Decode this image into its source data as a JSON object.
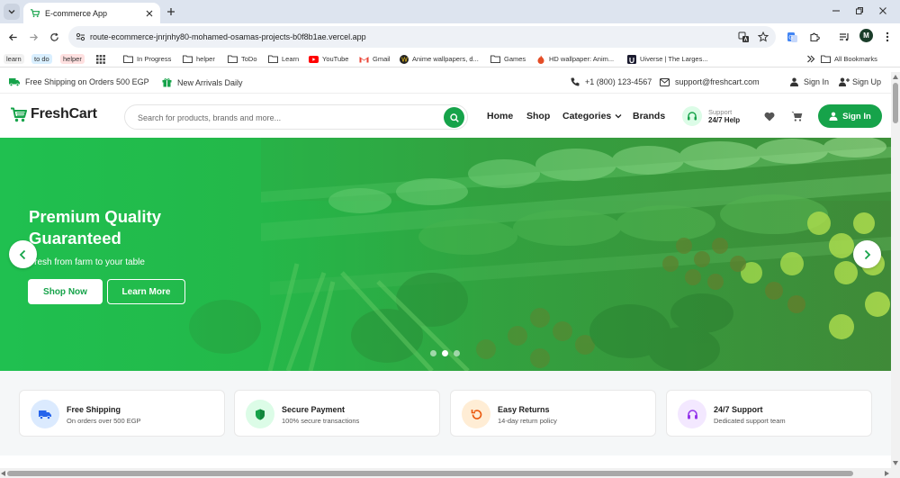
{
  "browser": {
    "tab_title": "E-commerce App",
    "url": "route-ecommerce-jnrjnhy80-mohamed-osamas-projects-b0f8b1ae.vercel.app",
    "profile_initial": "M",
    "bookmarks": [
      {
        "label": "learn",
        "icon": "chip"
      },
      {
        "label": "to do",
        "icon": "chip"
      },
      {
        "label": "helper",
        "icon": "chip"
      },
      {
        "label": "In Progress",
        "icon": "folder-icon"
      },
      {
        "label": "helper",
        "icon": "folder-icon"
      },
      {
        "label": "ToDo",
        "icon": "folder-icon"
      },
      {
        "label": "Learn",
        "icon": "folder-icon"
      },
      {
        "label": "YouTube",
        "icon": "youtube-icon"
      },
      {
        "label": "Gmail",
        "icon": "gmail-icon"
      },
      {
        "label": "Anime wallpapers, d...",
        "icon": "site-icon"
      },
      {
        "label": "Games",
        "icon": "folder-icon"
      },
      {
        "label": "HD wallpaper: Anim...",
        "icon": "site-icon"
      },
      {
        "label": "Uiverse | The Larges...",
        "icon": "site-icon"
      }
    ],
    "all_bookmarks": "All Bookmarks"
  },
  "topbar": {
    "shipping": "Free Shipping on Orders 500 EGP",
    "arrivals": "New Arrivals Daily",
    "phone": "+1 (800) 123-4567",
    "email": "support@freshcart.com",
    "sign_in": "Sign In",
    "sign_up": "Sign Up"
  },
  "header": {
    "logo": "FreshCart",
    "search_placeholder": "Search for products, brands and more...",
    "nav": [
      "Home",
      "Shop",
      "Categories",
      "Brands"
    ],
    "support_label": "Support",
    "support_hours": "24/7 Help",
    "sign_in_button": "Sign In"
  },
  "hero": {
    "title": "Premium Quality Guaranteed",
    "subtitle": "Fresh from farm to your table",
    "primary_button": "Shop Now",
    "secondary_button": "Learn More",
    "slides": 3,
    "active_slide": 2
  },
  "features": [
    {
      "title": "Free Shipping",
      "desc": "On orders over 500 EGP",
      "icon": "truck-icon",
      "color": "#2563eb",
      "bg": "#dbeafe"
    },
    {
      "title": "Secure Payment",
      "desc": "100% secure transactions",
      "icon": "shield-icon",
      "color": "#16a34a",
      "bg": "#dcfce7"
    },
    {
      "title": "Easy Returns",
      "desc": "14-day return policy",
      "icon": "return-icon",
      "color": "#ea580c",
      "bg": "#ffedd5"
    },
    {
      "title": "24/7 Support",
      "desc": "Dedicated support team",
      "icon": "headset-icon",
      "color": "#9333ea",
      "bg": "#f3e8ff"
    }
  ],
  "colors": {
    "brand": "#16a34a",
    "tabbar": "#dde4ef"
  }
}
